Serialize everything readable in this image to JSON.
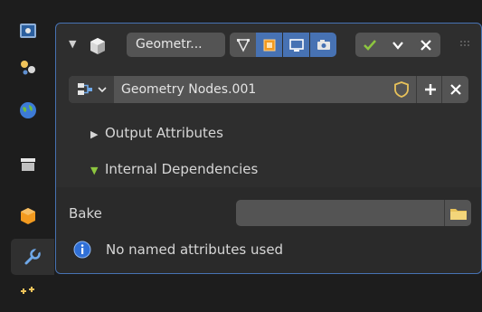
{
  "modifier": {
    "name": "Geometr...",
    "node_tree": "Geometry Nodes.001"
  },
  "sections": {
    "output_attributes": "Output Attributes",
    "internal_dependencies": "Internal Dependencies"
  },
  "bake": {
    "label": "Bake",
    "path": ""
  },
  "info": {
    "message": "No named attributes used"
  },
  "colors": {
    "accent": "#4772b3",
    "check": "#8dc63f",
    "folder": "#e8c25a"
  }
}
